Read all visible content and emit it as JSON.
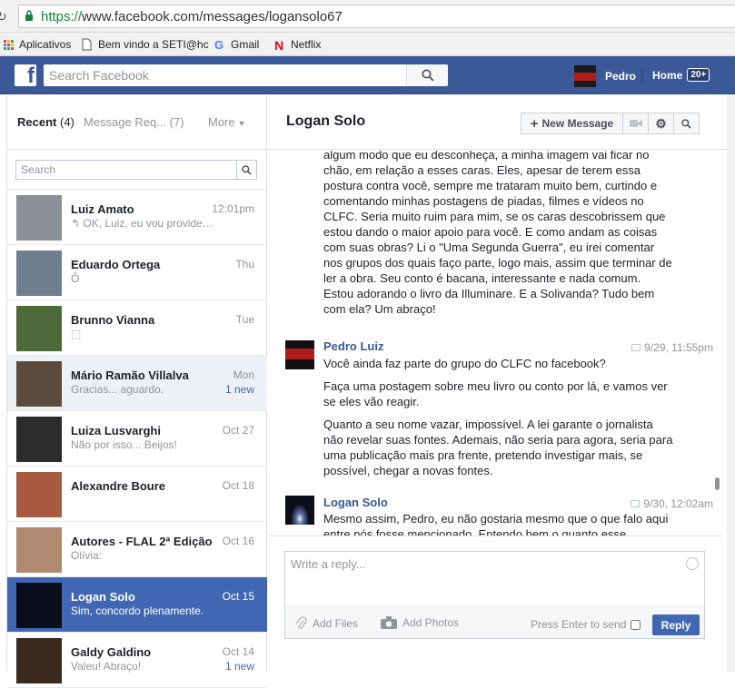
{
  "browser": {
    "url_proto": "https://",
    "url_rest": "www.facebook.com/messages/logansolo67",
    "bookmarks": [
      {
        "label": "Aplicativos",
        "icon": "apps-grid-icon"
      },
      {
        "label": "Bem vindo a SETI@hc",
        "icon": "page-icon"
      },
      {
        "label": "Gmail",
        "icon": "google-icon"
      },
      {
        "label": "Netflix",
        "icon": "netflix-icon"
      }
    ]
  },
  "header": {
    "search_placeholder": "Search Facebook",
    "user_name": "Pedro",
    "home_label": "Home",
    "home_count": "20+",
    "brand_color": "#3b5998"
  },
  "left": {
    "tabs": [
      {
        "label": "Recent",
        "count": "(4)"
      },
      {
        "label": "Message Req...",
        "count": "(7)"
      },
      {
        "label": "More"
      }
    ],
    "search_placeholder": "Search",
    "threads": [
      {
        "name": "Luiz Amato",
        "time": "12:01pm",
        "snippet": "↰ OK, Luiz, eu vou providen...",
        "state": "normal",
        "avatar": "#8a8f98"
      },
      {
        "name": "Eduardo Ortega",
        "time": "Thu",
        "snippet": "Ô",
        "state": "normal",
        "avatar": "#6f7f8f"
      },
      {
        "name": "Brunno Vianna",
        "time": "Tue",
        "snippet": "⬚",
        "state": "normal",
        "avatar": "#4f6a3a"
      },
      {
        "name": "Mário Ramão Villalva",
        "time": "Mon",
        "snippet": "Gracias... aguardo.",
        "new": "1 new",
        "state": "unread",
        "avatar": "#5b4a3e"
      },
      {
        "name": "Luiza Lusvarghi",
        "time": "Oct 27",
        "snippet": "Não por isso... Beijos!",
        "state": "normal",
        "avatar": "#2c2c2c"
      },
      {
        "name": "Alexandre Boure",
        "time": "Oct 18",
        "snippet": "",
        "state": "normal",
        "avatar": "#a85a40"
      },
      {
        "name": "Autores - FLAL 2ª Edição",
        "time": "Oct 16",
        "snippet": "Olívia:",
        "state": "normal",
        "avatar": "#b08a70"
      },
      {
        "name": "Logan Solo",
        "time": "Oct 15",
        "snippet": "Sim, concordo plenamente.",
        "state": "selected",
        "avatar": "#0a0d1a"
      },
      {
        "name": "Galdy Galdino",
        "time": "Oct 14",
        "snippet": "Valeu! Abraço!",
        "new": "1 new",
        "state": "normal",
        "avatar": "#3a2a20"
      }
    ]
  },
  "conversation": {
    "title": "Logan Solo",
    "new_message_label": "New Message",
    "messages": [
      {
        "sender": "",
        "paragraphs": [
          "algum modo que eu desconheça, a minha imagem vai ficar no chão, em relação a esses caras. Eles, apesar de terem essa postura contra você, sempre me trataram muito bem, curtindo e comentando minhas postagens de piadas, filmes e vídeos no CLFC. Seria muito ruim para mim, se os caras descobrissem que estou dando o maior apoio para você. E como andam as coisas com suas obras? Li o \"Uma Segunda Guerra\", eu irei comentar nos grupos dos quais faço parte, logo mais, assim que terminar de ler a obra. Seu conto é bacana, interessante e nada comum. Estou adorando o livro da Illuminare. E a Solivanda? Tudo bem com ela? Um abraço!"
        ]
      },
      {
        "sender": "Pedro Luiz",
        "time": "9/29, 11:55pm",
        "paragraphs": [
          "Você ainda faz parte do grupo do CLFC no facebook?",
          "Faça uma postagem sobre meu livro ou conto por lá, e vamos ver se eles vão reagir.",
          "Quanto a seu nome vazar, impossível. A lei garante o jornalista não revelar suas fontes. Ademais, não seria para agora, seria para uma publicação mais pra frente, pretendo investigar mais, se possível, chegar a novas fontes."
        ]
      },
      {
        "sender": "Logan Solo",
        "time": "9/30, 12:02am",
        "paragraphs": [
          "Mesmo assim, Pedro, eu não gostaria mesmo que o que falo aqui entre nós fosse mencionado. Entendo bem o quanto esse"
        ]
      }
    ]
  },
  "compose": {
    "placeholder": "Write a reply...",
    "add_files": "Add Files",
    "add_photos": "Add Photos",
    "enter_to_send": "Press Enter to send",
    "reply_label": "Reply"
  }
}
